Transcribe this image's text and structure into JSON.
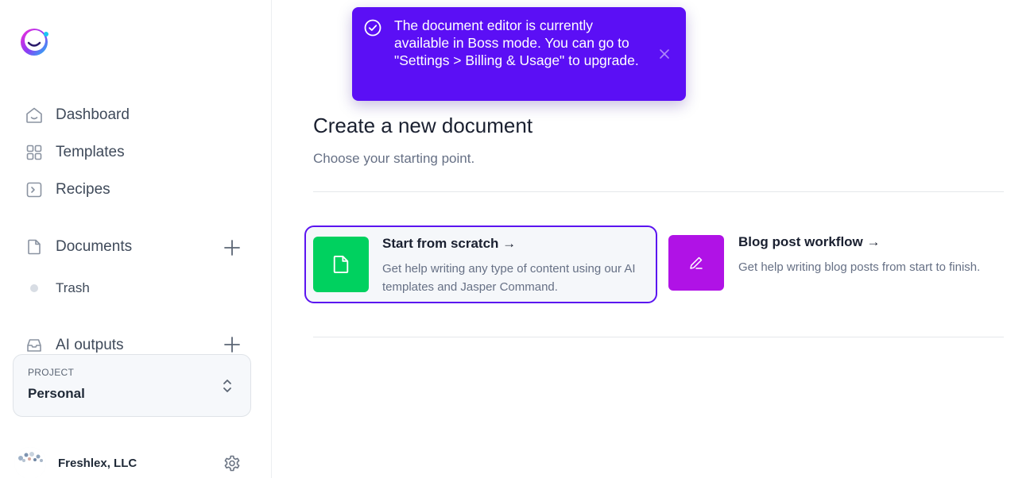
{
  "colors": {
    "accent": "#5b14f0",
    "toast_bg": "#5b0ff5",
    "scratch_tile": "#00d15f",
    "blog_tile": "#b012e6"
  },
  "sidebar": {
    "logo_icon": "jasper-logo-icon",
    "nav": [
      {
        "label": "Dashboard",
        "icon": "home-icon"
      },
      {
        "label": "Templates",
        "icon": "grid-icon"
      },
      {
        "label": "Recipes",
        "icon": "terminal-icon"
      }
    ],
    "documents": {
      "label": "Documents",
      "icon": "document-icon",
      "add_icon": "plus-icon"
    },
    "trash": {
      "label": "Trash"
    },
    "ai_outputs": {
      "label": "AI outputs",
      "icon": "inbox-icon",
      "add_icon": "plus-icon"
    },
    "project": {
      "caption": "PROJECT",
      "value": "Personal",
      "icon": "chevron-up-down-icon"
    },
    "account": {
      "name": "Freshlex, LLC",
      "icon": "gear-icon"
    }
  },
  "main": {
    "title": "Create a new document",
    "subtitle": "Choose your starting point.",
    "cards": [
      {
        "title": "Start from scratch →",
        "description": "Get help writing any type of content using our AI templates and Jasper Command.",
        "icon": "document-icon",
        "selected": true
      },
      {
        "title": "Blog post workflow →",
        "description": "Get help writing blog posts from start to finish.",
        "icon": "pencil-icon",
        "selected": false
      }
    ]
  },
  "toast": {
    "message": "The document editor is currently available in Boss mode. You can go to \"Settings > Billing & Usage\" to upgrade.",
    "icon": "check-circle-icon",
    "close_icon": "close-icon"
  }
}
